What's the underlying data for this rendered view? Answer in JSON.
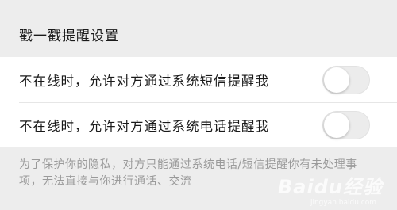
{
  "section": {
    "title": "戳一戳提醒设置"
  },
  "settings": [
    {
      "label": "不在线时，允许对方通过系统短信提醒我",
      "enabled": false
    },
    {
      "label": "不在线时，允许对方通过系统电话提醒我",
      "enabled": false
    }
  ],
  "footnote": {
    "text": "为了保护你的隐私，对方只能通过系统电话/短信提醒你有未处理事项，无法直接与你进行通话、交流"
  },
  "watermark": {
    "text": "Baidu经验",
    "sub": "jingyan.baidu.com"
  },
  "colors": {
    "background": "#ededed",
    "card": "#ffffff",
    "toggle_off": "#ececec"
  }
}
